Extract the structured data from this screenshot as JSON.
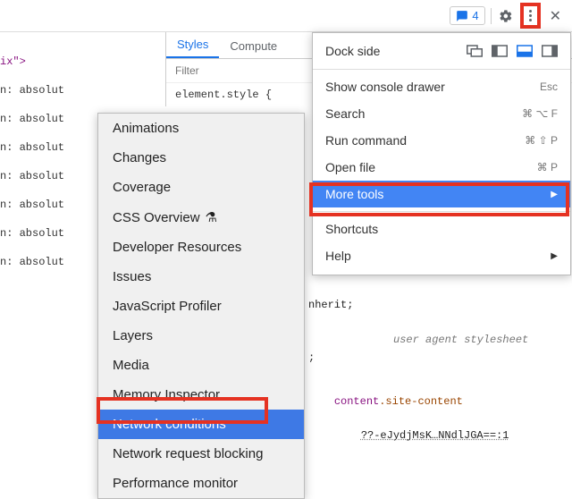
{
  "toolbar": {
    "feedback_count": "4"
  },
  "code": {
    "ix": "ix\">",
    "lines": [
      "n: absolut",
      "n: absolut",
      "n: absolut",
      "n: absolut",
      "n: absolut",
      "n: absolut",
      "n: absolut"
    ]
  },
  "styles_panel": {
    "tabs": {
      "styles": "Styles",
      "computed": "Compute"
    },
    "filter_placeholder": "Filter",
    "element_style": "element.style {",
    "inherit": "nherit;",
    "ua_label": "user agent stylesheet",
    "frag_brace": ";",
    "sel_content": "content",
    "sel_site": ".site-content",
    "token": "??-eJydjMsK…NNdlJGA==:1"
  },
  "dock": {
    "label": "Dock side"
  },
  "menu": {
    "show_console": "Show console drawer",
    "show_console_key": "Esc",
    "search": "Search",
    "search_key": "⌘ ⌥ F",
    "run_cmd": "Run command",
    "run_cmd_key": "⌘ ⇧ P",
    "open_file": "Open file",
    "open_file_key": "⌘ P",
    "more_tools": "More tools",
    "shortcuts": "Shortcuts",
    "help": "Help"
  },
  "submenu": {
    "items": [
      "Animations",
      "Changes",
      "Coverage",
      "CSS Overview",
      "Developer Resources",
      "Issues",
      "JavaScript Profiler",
      "Layers",
      "Media",
      "Memory Inspector",
      "Network conditions",
      "Network request blocking",
      "Performance monitor"
    ]
  }
}
